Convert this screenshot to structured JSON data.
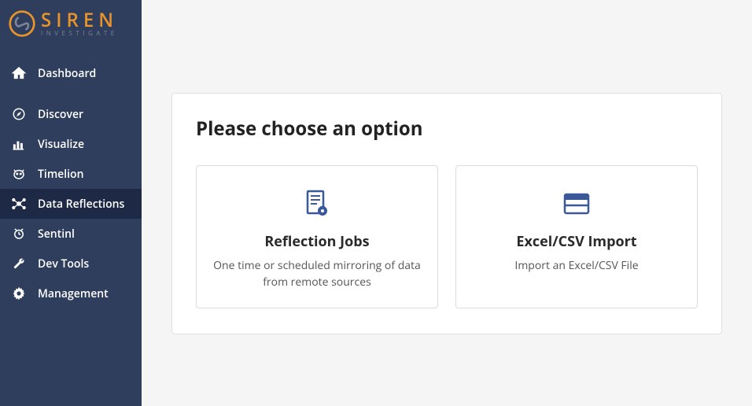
{
  "brand": {
    "name": "SIREN",
    "subtitle": "INVESTIGATE"
  },
  "sidebar": {
    "items": [
      {
        "label": "Dashboard"
      },
      {
        "label": "Discover"
      },
      {
        "label": "Visualize"
      },
      {
        "label": "Timelion"
      },
      {
        "label": "Data Reflections"
      },
      {
        "label": "Sentinl"
      },
      {
        "label": "Dev Tools"
      },
      {
        "label": "Management"
      }
    ]
  },
  "main": {
    "heading": "Please choose an option",
    "cards": [
      {
        "title": "Reflection Jobs",
        "description": "One time or scheduled mirroring of data from remote sources"
      },
      {
        "title": "Excel/CSV Import",
        "description": "Import an Excel/CSV File"
      }
    ]
  }
}
